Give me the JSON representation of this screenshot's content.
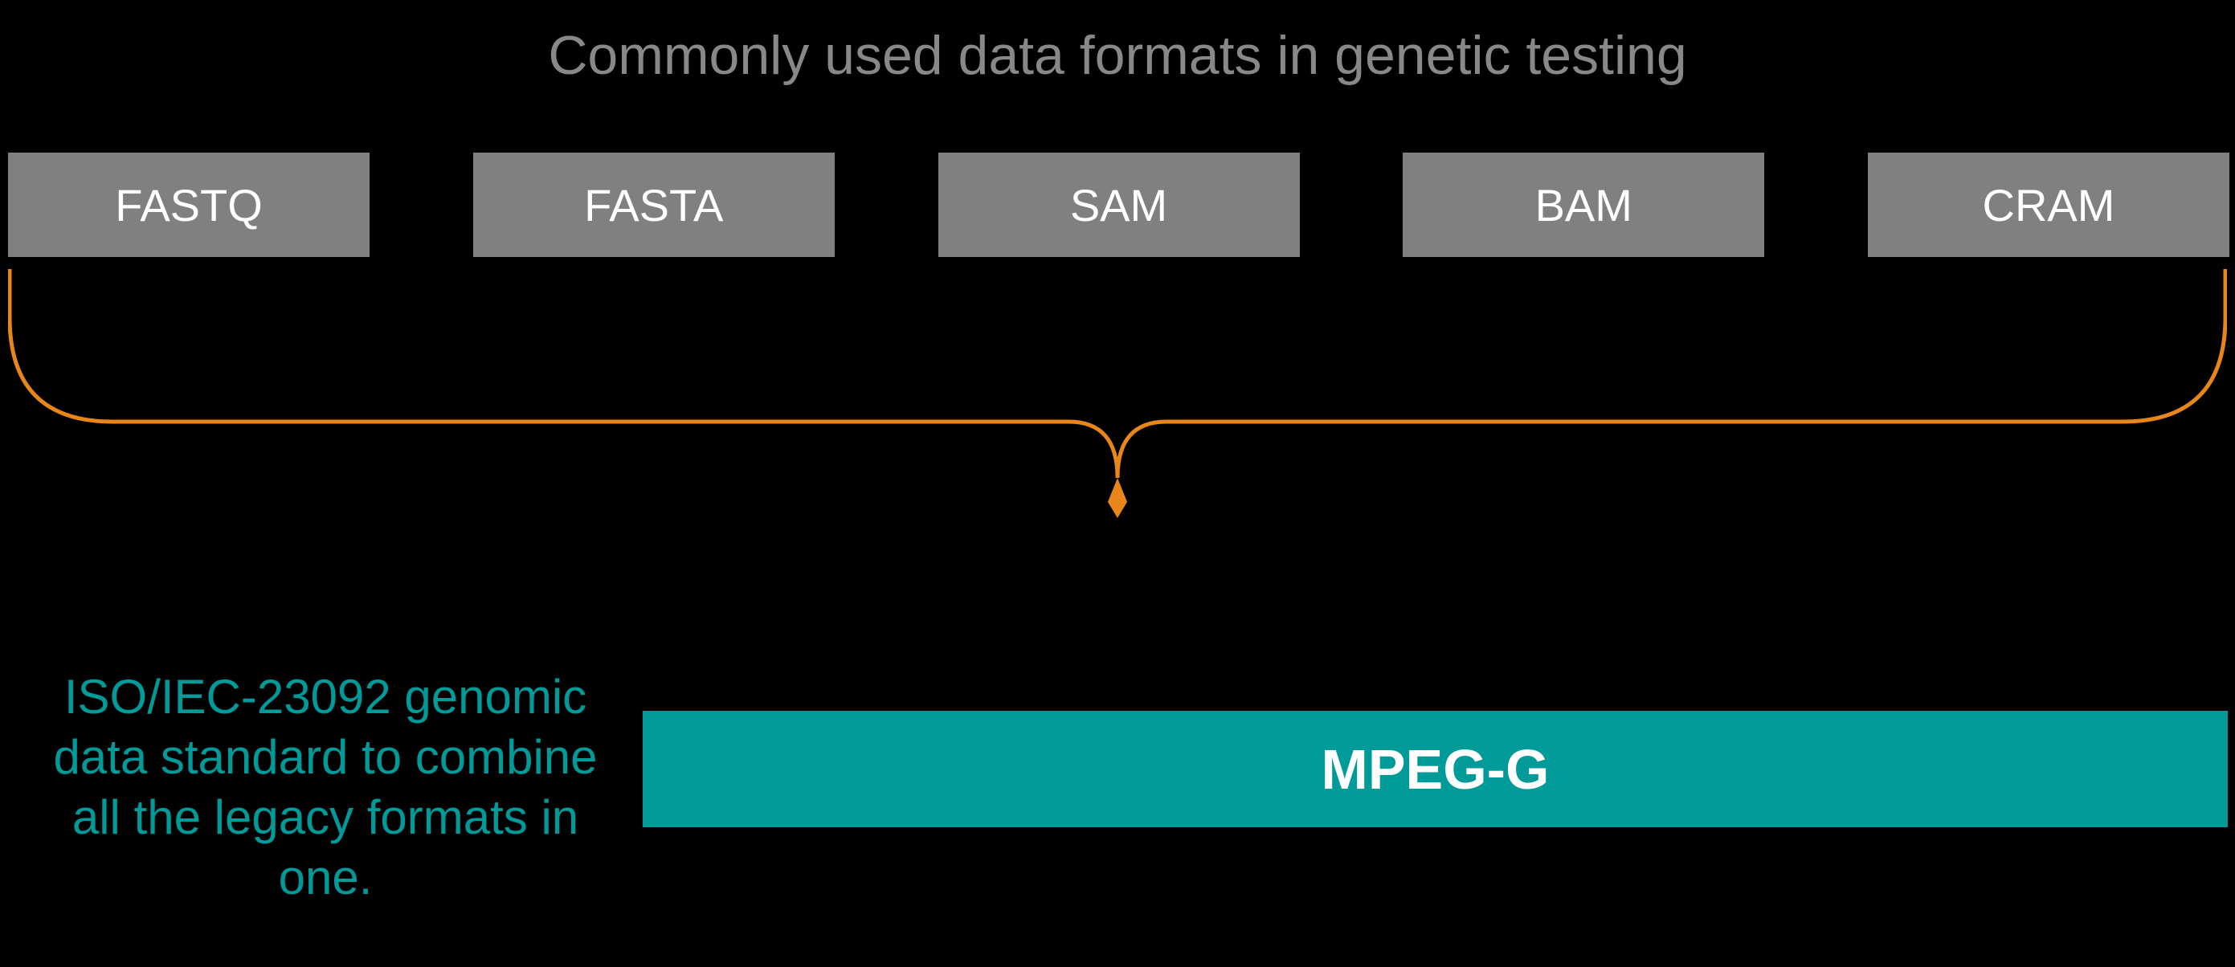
{
  "title": "Commonly used data formats in genetic testing",
  "formats": [
    {
      "label": "FASTQ"
    },
    {
      "label": "FASTA"
    },
    {
      "label": "SAM"
    },
    {
      "label": "BAM"
    },
    {
      "label": "CRAM"
    }
  ],
  "description": "ISO/IEC-23092 genomic data standard to combine all the legacy formats in one.",
  "combined_format": "MPEG-G",
  "colors": {
    "background": "#000000",
    "title_text": "#888888",
    "format_box_bg": "#808080",
    "format_box_text": "#ffffff",
    "brace": "#e8861a",
    "accent": "#009a99",
    "mpeg_text": "#ffffff"
  }
}
